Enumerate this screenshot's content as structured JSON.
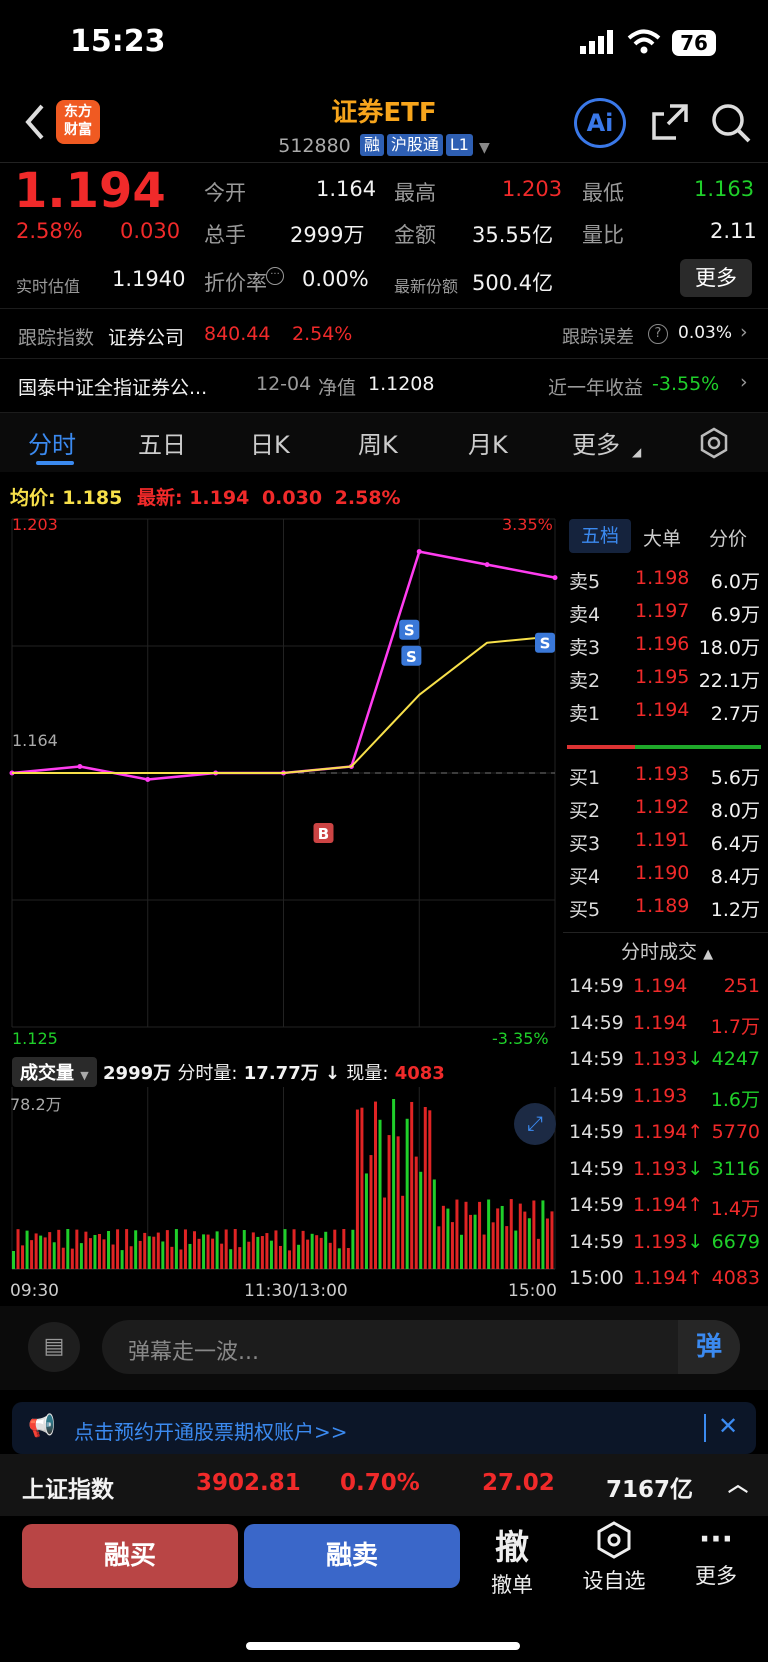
{
  "status_bar": {
    "time": "15:23",
    "battery": "76"
  },
  "header": {
    "title": "证券ETF",
    "code": "512880",
    "tags": [
      "融",
      "沪股通",
      "L1"
    ],
    "logo": "东方\n财富",
    "ai": "Ai"
  },
  "quote": {
    "price": "1.194",
    "change_pct": "2.58%",
    "change": "0.030",
    "iopv_label": "实时估值",
    "iopv": "1.1940",
    "open_label": "今开",
    "open": "1.164",
    "high_label": "最高",
    "high": "1.203",
    "low_label": "最低",
    "low": "1.163",
    "volume_label": "总手",
    "volume": "2999万",
    "amount_label": "金额",
    "amount": "35.55亿",
    "ratio_label": "量比",
    "ratio": "2.11",
    "discount_label": "折价率",
    "discount": "0.00%",
    "shares_label": "最新份额",
    "shares": "500.4亿",
    "more": "更多"
  },
  "tracking": {
    "label": "跟踪指数",
    "index_name": "证券公司",
    "index_value": "840.44",
    "index_pct": "2.54%",
    "error_label": "跟踪误差",
    "error_value": "0.03%"
  },
  "fund": {
    "name": "国泰中证全指证券公...",
    "nav_date": "12-04",
    "nav_label": "净值",
    "nav": "1.1208",
    "year_label": "近一年收益",
    "year_return": "-3.55%"
  },
  "tabs": [
    "分时",
    "五日",
    "日K",
    "周K",
    "月K",
    "更多"
  ],
  "chart_legend": {
    "avg_label": "均价:",
    "avg": "1.185",
    "latest_label": "最新:",
    "latest": "1.194",
    "chg": "0.030",
    "pct": "2.58%"
  },
  "chart_axis": {
    "top_price": "1.203",
    "top_pct": "3.35%",
    "mid_price": "1.164",
    "bottom_price": "1.125",
    "bottom_pct": "-3.35%",
    "vol_max": "78.2万",
    "times": [
      "09:30",
      "11:30/13:00",
      "15:00"
    ]
  },
  "volume_header": {
    "label": "成交量",
    "total": "2999万",
    "minute_label": "分时量:",
    "minute": "17.77万",
    "current_label": "现量:",
    "current": "4083"
  },
  "markers": {
    "buy": "B",
    "sell": "S"
  },
  "chart_data": {
    "type": "line",
    "title": "",
    "x": [
      "09:30",
      "10:00",
      "10:30",
      "11:00",
      "11:30/13:00",
      "13:30",
      "14:00",
      "14:30",
      "15:00"
    ],
    "series": [
      {
        "name": "最新",
        "values": [
          1.164,
          1.165,
          1.163,
          1.164,
          1.164,
          1.165,
          1.198,
          1.196,
          1.194
        ]
      },
      {
        "name": "均价",
        "values": [
          1.164,
          1.164,
          1.164,
          1.164,
          1.164,
          1.165,
          1.176,
          1.184,
          1.185
        ]
      }
    ],
    "ylim": [
      1.125,
      1.203
    ],
    "xlabel": "",
    "ylabel": ""
  },
  "book": {
    "tabs": [
      "五档",
      "大单",
      "分价"
    ],
    "asks": [
      {
        "label": "卖5",
        "price": "1.198",
        "vol": "6.0万"
      },
      {
        "label": "卖4",
        "price": "1.197",
        "vol": "6.9万"
      },
      {
        "label": "卖3",
        "price": "1.196",
        "vol": "18.0万"
      },
      {
        "label": "卖2",
        "price": "1.195",
        "vol": "22.1万"
      },
      {
        "label": "卖1",
        "price": "1.194",
        "vol": "2.7万"
      }
    ],
    "bids": [
      {
        "label": "买1",
        "price": "1.193",
        "vol": "5.6万"
      },
      {
        "label": "买2",
        "price": "1.192",
        "vol": "8.0万"
      },
      {
        "label": "买3",
        "price": "1.191",
        "vol": "6.4万"
      },
      {
        "label": "买4",
        "price": "1.190",
        "vol": "8.4万"
      },
      {
        "label": "买5",
        "price": "1.189",
        "vol": "1.2万"
      }
    ],
    "trades_title": "分时成交",
    "trades": [
      {
        "t": "14:59",
        "p": "1.194",
        "d": "",
        "v": "251",
        "c": "red"
      },
      {
        "t": "14:59",
        "p": "1.194",
        "d": "",
        "v": "1.7万",
        "c": "red"
      },
      {
        "t": "14:59",
        "p": "1.193",
        "d": "↓",
        "v": "4247",
        "c": "green"
      },
      {
        "t": "14:59",
        "p": "1.193",
        "d": "",
        "v": "1.6万",
        "c": "green"
      },
      {
        "t": "14:59",
        "p": "1.194",
        "d": "↑",
        "v": "5770",
        "c": "red"
      },
      {
        "t": "14:59",
        "p": "1.193",
        "d": "↓",
        "v": "3116",
        "c": "green"
      },
      {
        "t": "14:59",
        "p": "1.194",
        "d": "↑",
        "v": "1.4万",
        "c": "red"
      },
      {
        "t": "14:59",
        "p": "1.193",
        "d": "↓",
        "v": "6679",
        "c": "green"
      },
      {
        "t": "15:00",
        "p": "1.194",
        "d": "↑",
        "v": "4083",
        "c": "red"
      }
    ]
  },
  "danmu": {
    "placeholder": "弹幕走一波...",
    "send": "弹"
  },
  "promo": {
    "text": "点击预约开通股票期权账户>>"
  },
  "index_bar": {
    "name": "上证指数",
    "value": "3902.81",
    "pct": "0.70%",
    "chg": "27.02",
    "amount": "7167亿"
  },
  "actions": {
    "buy": "融买",
    "sell": "融卖",
    "cancel_icon": "撤",
    "cancel": "撤单",
    "watch": "设自选",
    "more": "更多"
  },
  "colors": {
    "up": "#f02a2a",
    "down": "#1fcf2a",
    "avg": "#f7e04a",
    "price": "#ff3df0",
    "accent": "#f7a51c",
    "buy_btn": "#b94545",
    "sell_btn": "#3a67c9"
  }
}
